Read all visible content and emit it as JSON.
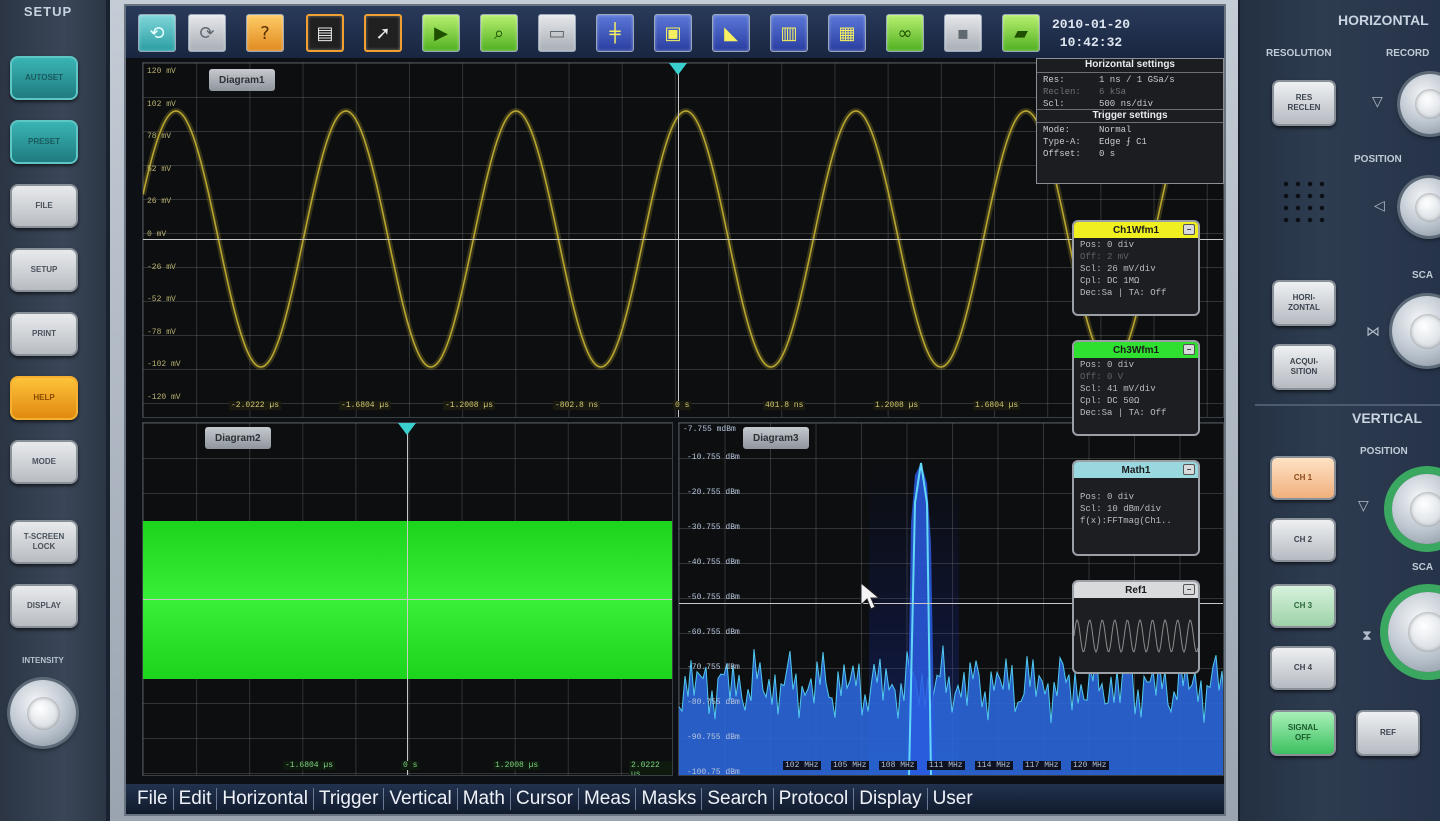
{
  "left_panel": {
    "title": "SETUP",
    "buttons": [
      {
        "label": "AUTOSET",
        "style": "teal"
      },
      {
        "label": "PRESET",
        "style": "teal"
      },
      {
        "label": "FILE",
        "style": "grey"
      },
      {
        "label": "SETUP",
        "style": "grey"
      },
      {
        "label": "PRINT",
        "style": "grey"
      },
      {
        "label": "HELP",
        "style": "orange"
      },
      {
        "label": "MODE",
        "style": "grey"
      },
      {
        "label": "T-SCREEN\nLOCK",
        "style": "grey"
      },
      {
        "label": "DISPLAY",
        "style": "grey"
      }
    ],
    "intensity_label": "INTENSITY"
  },
  "right_panel": {
    "horizontal_title": "HORIZONTAL",
    "resolution_label": "RESOLUTION",
    "record_label": "RECORD",
    "position_label": "POSITION",
    "scale_label": "SCA",
    "res_button": "RES\nRECLEN",
    "horiz_button": "HORI-\nZONTAL",
    "acq_button": "ACQUI-\nSITION",
    "vertical_title": "VERTICAL",
    "v_position_label": "POSITION",
    "v_scale_label": "SCA",
    "ch_buttons": [
      "CH 1",
      "CH 2",
      "CH 3",
      "CH 4"
    ],
    "signal_off": "SIGNAL\nOFF",
    "ref_button": "REF"
  },
  "toolbar": {
    "buttons": [
      {
        "icon": "undo-arrow-icon",
        "glyph": "⟲",
        "style": "teal"
      },
      {
        "icon": "redo-arrow-icon",
        "glyph": "⟳",
        "style": "grey"
      },
      {
        "icon": "help-icon",
        "glyph": "?",
        "style": "orange"
      },
      {
        "icon": "toolbar-config-icon",
        "glyph": "▤",
        "style": "orangeframe"
      },
      {
        "icon": "pointer-icon",
        "glyph": "➚",
        "style": "orangeframe"
      },
      {
        "icon": "play-trace-icon",
        "glyph": "▶",
        "style": "green"
      },
      {
        "icon": "zoom-icon",
        "glyph": "⌕",
        "style": "green"
      },
      {
        "icon": "disabled-icon",
        "glyph": "▭",
        "style": "grey"
      },
      {
        "icon": "cursor-lines-icon",
        "glyph": "╪",
        "style": "blue"
      },
      {
        "icon": "measure-box-icon",
        "glyph": "▣",
        "style": "blue"
      },
      {
        "icon": "mask-icon",
        "glyph": "◣",
        "style": "blue"
      },
      {
        "icon": "histogram-icon",
        "glyph": "▥",
        "style": "blue"
      },
      {
        "icon": "spectrum-icon",
        "glyph": "▦",
        "style": "blue"
      },
      {
        "icon": "search-binoculars-icon",
        "glyph": "∞",
        "style": "green"
      },
      {
        "icon": "delete-icon",
        "glyph": "▪",
        "style": "grey"
      },
      {
        "icon": "screenshot-icon",
        "glyph": "▰",
        "style": "green"
      }
    ],
    "date": "2010-01-20",
    "time": "10:42:32"
  },
  "diagram1": {
    "tab": "Diagram1",
    "y_labels": [
      "120 mV",
      "102 mV",
      "78 mV",
      "52 mV",
      "26 mV",
      "0 mV",
      "-26 mV",
      "-52 mV",
      "-78 mV",
      "-102 mV",
      "-120 mV"
    ],
    "x_labels": [
      "-2.0222 µs",
      "-1.6804 µs",
      "-1.2008 µs",
      "-802.8 ns",
      "0 s",
      "401.8 ns",
      "1.2008 µs",
      "1.6804 µs"
    ],
    "trace_color": "#b8a630"
  },
  "diagram2": {
    "tab": "Diagram2",
    "x_labels": [
      "-1.6804 µs",
      "0 s",
      "1.2008 µs",
      "2.0222 µs"
    ],
    "trace_color": "#22ee22"
  },
  "diagram3": {
    "tab": "Diagram3",
    "y_labels": [
      "-10.755 dBm",
      "-20.755 dBm",
      "-30.755 dBm",
      "-40.755 dBm",
      "-50.755 dBm",
      "-60.755 dBm",
      "-70.755 dBm",
      "-80.755 dBm",
      "-90.755 dBm",
      "-100.75 dBm"
    ],
    "top_label": "-7.755 mdBm",
    "x_labels": [
      "102 MHz",
      "105 MHz",
      "108 MHz",
      "111 MHz",
      "114 MHz",
      "117 MHz",
      "120 MHz"
    ],
    "trace_color": "#3ab0e0"
  },
  "horizontal_settings": {
    "title": "Horizontal settings",
    "rows": [
      {
        "label": "Res:",
        "value": "1 ns / 1 GSa/s",
        "dim": false
      },
      {
        "label": "Reclen:",
        "value": "6 kSa",
        "dim": true
      },
      {
        "label": "Scl:",
        "value": "500 ns/div",
        "dim": false
      }
    ]
  },
  "trigger_settings": {
    "title": "Trigger settings",
    "rows": [
      {
        "label": "Mode:",
        "value": "Normal",
        "dim": false
      },
      {
        "label": "Type-A:",
        "value": "Edge ⨍ C1",
        "dim": false
      },
      {
        "label": "Offset:",
        "value": "0 s",
        "dim": false
      }
    ]
  },
  "channels": [
    {
      "name": "Ch1Wfm1",
      "color": "#f0f020",
      "rows": [
        {
          "t": "Pos: 0 div",
          "dim": false
        },
        {
          "t": "Off: 2 mV",
          "dim": true
        },
        {
          "t": "Scl: 26 mV/div",
          "dim": false
        },
        {
          "t": "Cpl: DC 1MΩ",
          "dim": false
        },
        {
          "t": "Dec:Sa | TA: Off",
          "dim": false
        }
      ]
    },
    {
      "name": "Ch3Wfm1",
      "color": "#30e030",
      "rows": [
        {
          "t": "Pos: 0 div",
          "dim": false
        },
        {
          "t": "Off: 0 V",
          "dim": true
        },
        {
          "t": "Scl: 41 mV/div",
          "dim": false
        },
        {
          "t": "Cpl: DC 50Ω",
          "dim": false
        },
        {
          "t": "Dec:Sa | TA: Off",
          "dim": false
        }
      ]
    },
    {
      "name": "Math1",
      "color": "#9ad8e0",
      "rows": [
        {
          "t": "",
          "dim": false
        },
        {
          "t": "Pos: 0 div",
          "dim": false
        },
        {
          "t": "Scl: 10 dBm/div",
          "dim": false
        },
        {
          "t": "f(x):FFTmag(Ch1..",
          "dim": false
        }
      ]
    },
    {
      "name": "Ref1",
      "color": "#d8dadc",
      "rows": []
    }
  ],
  "menu": [
    "File",
    "Edit",
    "Horizontal",
    "Trigger",
    "Vertical",
    "Math",
    "Cursor",
    "Meas",
    "Masks",
    "Search",
    "Protocol",
    "Display",
    "User"
  ]
}
